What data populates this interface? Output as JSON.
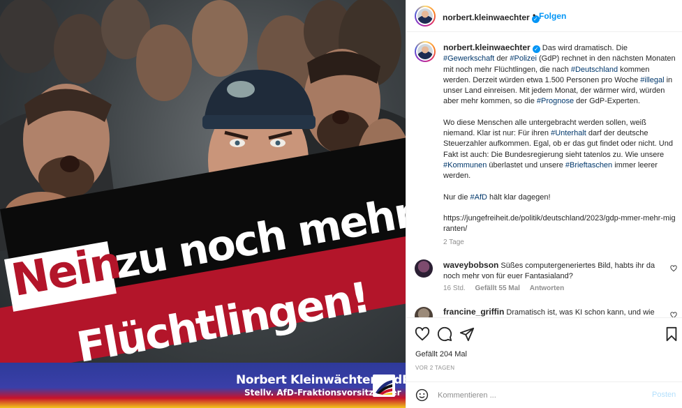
{
  "image": {
    "headline_word1": "Nein",
    "headline_line1": "zu noch mehr",
    "headline_line2": "Flüchtlingen!",
    "signature_name": "Norbert Kleinwächter, MdB",
    "signature_role": "Stellv. AfD-Fraktionsvorsitzender",
    "colors": {
      "red": "#b3152a",
      "black": "#0b0b0b",
      "blue": "#2e3a9a",
      "gold": "#f3c51b"
    }
  },
  "header": {
    "username": "norbert.kleinwaechter",
    "verified_icon": "check",
    "separator": "•",
    "follow_label": "Folgen"
  },
  "caption": {
    "username": "norbert.kleinwaechter",
    "p1_pre": "Das wird dramatisch. Die ",
    "tag_gewerkschaft": "#Gewerkschaft",
    "p1_a": " der ",
    "tag_polizei": "#Polizei",
    "p1_b": " (GdP) rechnet in den nächsten Monaten mit noch mehr Flüchtlingen, die nach ",
    "tag_deutschland": "#Deutschland",
    "p1_c": " kommen werden. Derzeit würden etwa 1.500 Personen pro Woche ",
    "tag_illegal": "#illegal",
    "p1_d": " in unser Land einreisen. Mit jedem Monat, der wärmer wird, würden aber mehr kommen, so die ",
    "tag_prognose": "#Prognose",
    "p1_e": " der GdP-Experten.",
    "p2_pre": "Wo diese Menschen alle untergebracht werden sollen, weiß niemand. Klar ist nur: Für ihren ",
    "tag_unterhalt": "#Unterhalt",
    "p2_a": " darf der deutsche Steuerzahler aufkommen. Egal, ob er das gut findet oder nicht. Und Fakt ist auch: Die Bundesregierung sieht tatenlos zu. Wie unsere ",
    "tag_kommunen": "#Kommunen",
    "p2_b": " überlastet und unsere ",
    "tag_brieftaschen": "#Brieftaschen",
    "p2_c": " immer leerer werden.",
    "p3_pre": "Nur die ",
    "tag_afd": "#AfD",
    "p3_a": " hält klar dagegen!",
    "link": "https://jungefreiheit.de/politik/deutschland/2023/gdp-mmer-mehr-migranten/",
    "time": "2 Tage"
  },
  "comments": [
    {
      "username": "waveybobson",
      "text": "Süßes computergeneriertes Bild, habts ihr da noch mehr von für euer Fantasialand?",
      "time": "16 Std.",
      "likes": "Gefällt 55 Mal",
      "reply_label": "Antworten"
    },
    {
      "username": "francine_griffin",
      "text": "Dramatisch ist, was KI schon kann, und wie sie"
    }
  ],
  "actions": {
    "likes": "Gefällt 204 Mal",
    "date": "VOR 2 TAGEN"
  },
  "add_comment": {
    "placeholder": "Kommentieren ...",
    "post_label": "Posten"
  }
}
